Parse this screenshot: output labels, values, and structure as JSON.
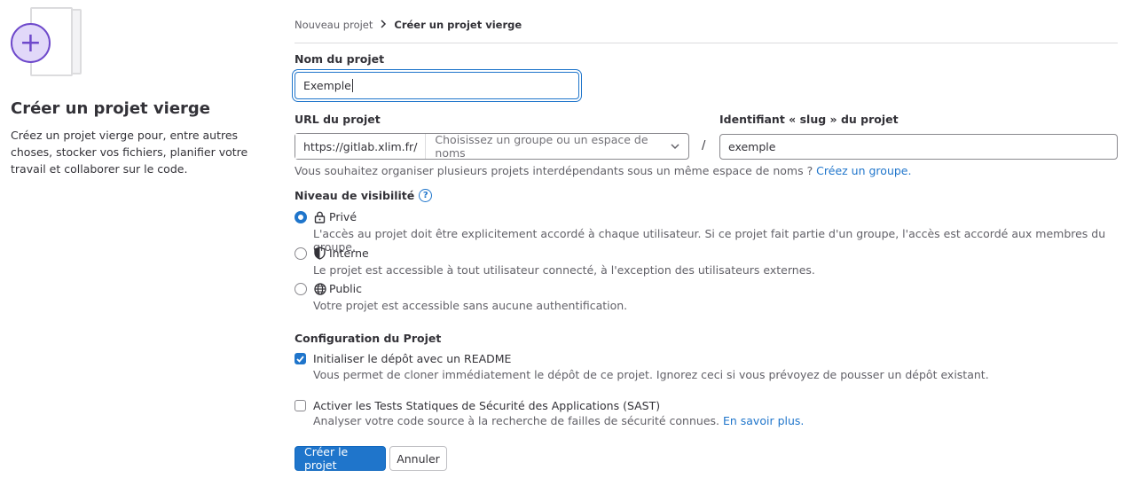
{
  "sidebar": {
    "title": "Créer un projet vierge",
    "description": "Créez un projet vierge pour, entre autres choses, stocker vos fichiers, planifier votre travail et collaborer sur le code."
  },
  "breadcrumb": {
    "parent": "Nouveau projet",
    "current": "Créer un projet vierge"
  },
  "form": {
    "project_name": {
      "label": "Nom du projet",
      "value": "Exemple"
    },
    "project_url": {
      "label": "URL du projet",
      "prefix": "https://gitlab.xlim.fr/",
      "namespace_placeholder": "Choisissez un groupe ou un espace de noms",
      "separator": "/"
    },
    "project_slug": {
      "label": "Identifiant « slug » du projet",
      "value": "exemple"
    },
    "group_help": {
      "text": "Vous souhaitez organiser plusieurs projets interdépendants sous un même espace de noms ? ",
      "link": "Créez un groupe."
    },
    "visibility": {
      "label": "Niveau de visibilité",
      "selected": "Privé",
      "options": [
        {
          "label": "Privé",
          "icon": "lock-icon",
          "description": "L'accès au projet doit être explicitement accordé à chaque utilisateur. Si ce projet fait partie d'un groupe, l'accès est accordé aux membres du groupe."
        },
        {
          "label": "Interne",
          "icon": "shield-icon",
          "description": "Le projet est accessible à tout utilisateur connecté, à l'exception des utilisateurs externes."
        },
        {
          "label": "Public",
          "icon": "globe-icon",
          "description": "Votre projet est accessible sans aucune authentification."
        }
      ]
    },
    "config": {
      "label": "Configuration du Projet",
      "readme": {
        "checked": true,
        "label": "Initialiser le dépôt avec un README",
        "description": "Vous permet de cloner immédiatement le dépôt de ce projet. Ignorez ceci si vous prévoyez de pousser un dépôt existant."
      },
      "sast": {
        "checked": false,
        "label": "Activer les Tests Statiques de Sécurité des Applications (SAST)",
        "description": "Analyser votre code source à la recherche de failles de sécurité connues. ",
        "link": "En savoir plus."
      }
    },
    "buttons": {
      "create": "Créer le projet",
      "cancel": "Annuler"
    }
  },
  "colors": {
    "accent": "#1f75cb",
    "purple": "#6e49cb"
  }
}
